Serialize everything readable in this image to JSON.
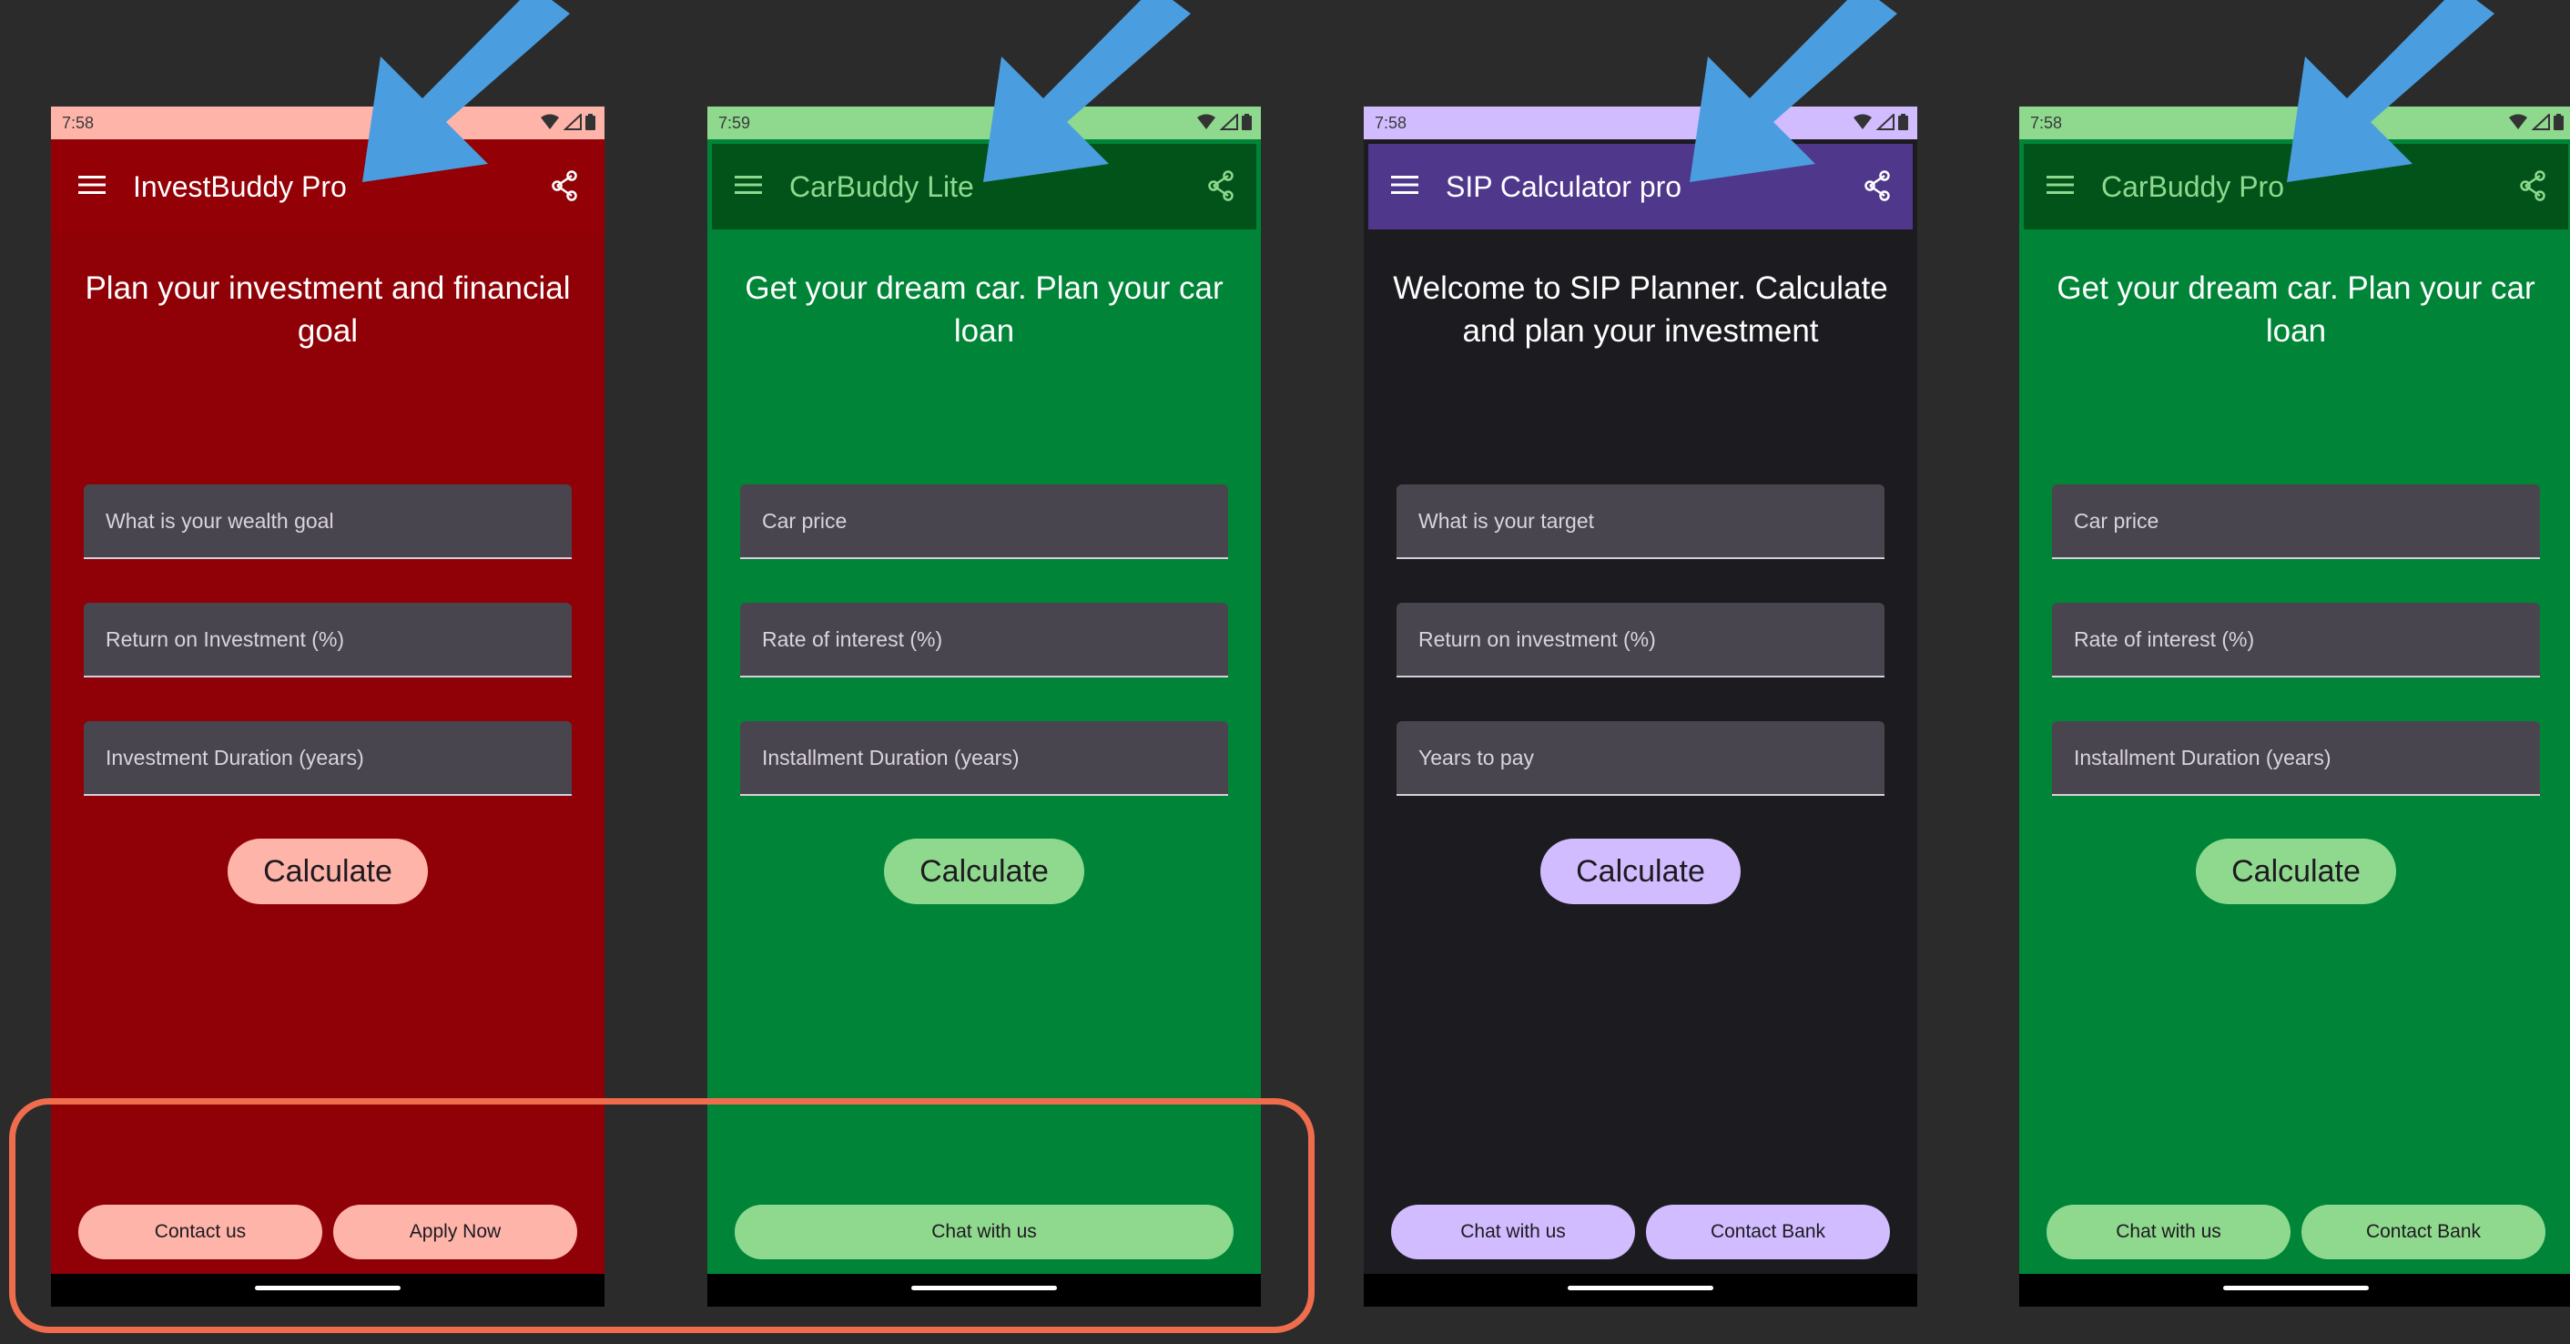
{
  "phones": [
    {
      "status_time": "7:58",
      "app_title": "InvestBuddy Pro",
      "headline": "Plan your investment and financial goal",
      "fields": [
        "What is your wealth goal",
        "Return on Investment (%)",
        "Investment Duration (years)"
      ],
      "calculate_label": "Calculate",
      "bottom_buttons": [
        "Contact us",
        "Apply Now"
      ],
      "colors": {
        "status_bar": "#ffb4aa",
        "app_bar": "#930006",
        "background": "#8f0007",
        "title_text": "#ffffff",
        "headline_text": "#ffffff",
        "button": "#ffb4aa"
      }
    },
    {
      "status_time": "7:59",
      "app_title": "CarBuddy Lite",
      "headline": "Get your dream car. Plan your car loan",
      "fields": [
        "Car price",
        "Rate of interest (%)",
        "Installment Duration (years)"
      ],
      "calculate_label": "Calculate",
      "bottom_buttons": [
        "Chat with us"
      ],
      "colors": {
        "status_bar": "#8ed98e",
        "app_bar": "#015319",
        "background": "#008538",
        "title_text": "#8ed98e",
        "headline_text": "#ffffff",
        "button": "#8ed98e"
      }
    },
    {
      "status_time": "7:58",
      "app_title": "SIP Calculator pro",
      "headline": "Welcome to SIP Planner. Calculate and plan your investment",
      "fields": [
        "What is your target",
        "Return on investment (%)",
        "Years to pay"
      ],
      "calculate_label": "Calculate",
      "bottom_buttons": [
        "Chat with us",
        "Contact Bank"
      ],
      "colors": {
        "status_bar": "#d0bcff",
        "app_bar": "#4f378b",
        "background": "#1c1b1f",
        "title_text": "#ffffff",
        "headline_text": "#ffffff",
        "button": "#d0bcff"
      }
    },
    {
      "status_time": "7:58",
      "app_title": "CarBuddy Pro",
      "headline": "Get your dream car. Plan your car loan",
      "fields": [
        "Car price",
        "Rate of interest (%)",
        "Installment Duration (years)"
      ],
      "calculate_label": "Calculate",
      "bottom_buttons": [
        "Chat with us",
        "Contact Bank"
      ],
      "colors": {
        "status_bar": "#8ed98e",
        "app_bar": "#015319",
        "background": "#008538",
        "title_text": "#8ed98e",
        "headline_text": "#ffffff",
        "button": "#8ed98e"
      }
    }
  ],
  "annotation_colors": {
    "arrow": "#4a9ee0",
    "highlight_box": "#ef6d4c"
  }
}
